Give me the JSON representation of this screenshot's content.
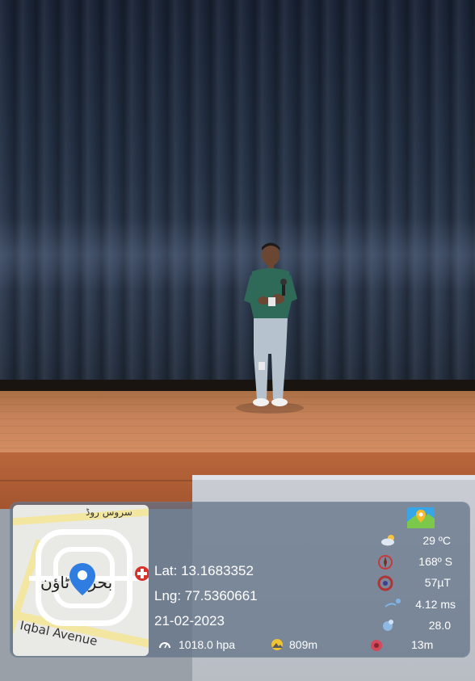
{
  "overlay": {
    "latitude": "Lat: 13.1683352",
    "longitude": "Lng: 77.5360661",
    "date": "21-02-2023",
    "temperature": "29 ºC",
    "heading": "168º S",
    "magnetic_field": "57µT",
    "wind_speed": "4.12 ms",
    "humidity": "28.0",
    "pressure": "1018.0 hpa",
    "altitude": "809m",
    "accuracy": "13m"
  },
  "map": {
    "road_label_top": "سروس روڈ",
    "place_label": "بحریہ ٹاؤن",
    "avenue_label": "Iqbal Avenue",
    "pin_color": "#2f7de1"
  },
  "icons": {
    "app_logo": "map-app-logo-icon",
    "weather": "cloud-sun-icon",
    "compass": "compass-icon",
    "magnet": "magnet-icon",
    "wind": "wind-icon",
    "humidity": "humidity-icon",
    "pressure": "pressure-icon",
    "altitude": "mountain-icon",
    "accuracy": "target-icon"
  }
}
